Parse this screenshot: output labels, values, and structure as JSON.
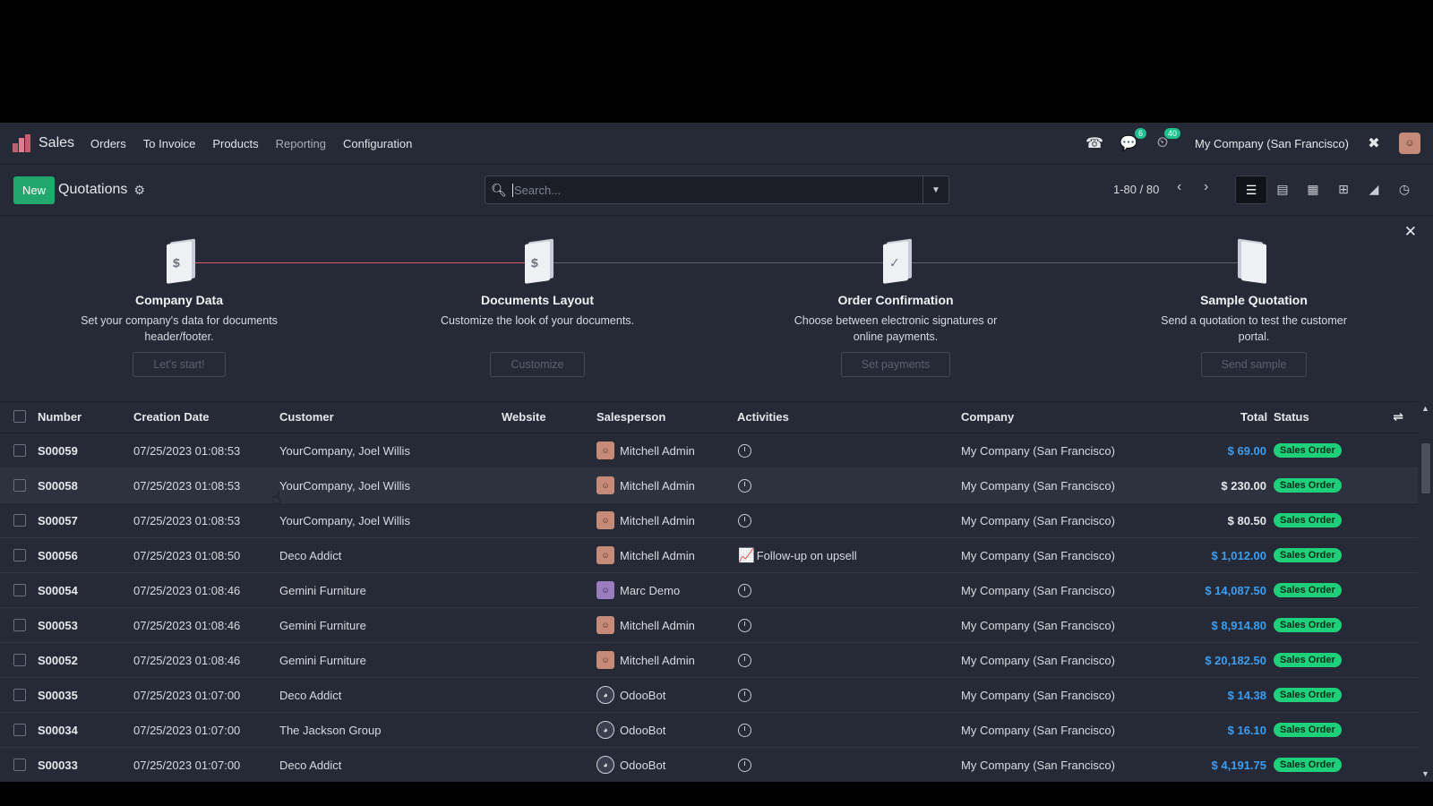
{
  "nav": {
    "app_name": "Sales",
    "menu": [
      "Orders",
      "To Invoice",
      "Products",
      "Reporting",
      "Configuration"
    ],
    "chat_badge": "6",
    "activity_badge": "40",
    "company": "My Company (San Francisco)"
  },
  "control": {
    "new_label": "New",
    "title": "Quotations",
    "search_placeholder": "Search...",
    "pager": "1-80 / 80"
  },
  "onboarding": {
    "steps": [
      {
        "title": "Company Data",
        "desc": "Set your company's data for documents header/footer.",
        "button": "Let's start!"
      },
      {
        "title": "Documents Layout",
        "desc": "Customize the look of your documents.",
        "button": "Customize"
      },
      {
        "title": "Order Confirmation",
        "desc": "Choose between electronic signatures or online payments.",
        "button": "Set payments"
      },
      {
        "title": "Sample Quotation",
        "desc": "Send a quotation to test the customer portal.",
        "button": "Send sample"
      }
    ]
  },
  "table": {
    "headers": {
      "number": "Number",
      "date": "Creation Date",
      "customer": "Customer",
      "website": "Website",
      "salesperson": "Salesperson",
      "activities": "Activities",
      "company": "Company",
      "total": "Total",
      "status": "Status"
    },
    "rows": [
      {
        "number": "S00059",
        "date": "07/25/2023 01:08:53",
        "customer": "YourCompany, Joel Willis",
        "salesperson": "Mitchell Admin",
        "activity": "",
        "company": "My Company (San Francisco)",
        "total": "$ 69.00",
        "status": "Sales Order"
      },
      {
        "number": "S00058",
        "date": "07/25/2023 01:08:53",
        "customer": "YourCompany, Joel Willis",
        "salesperson": "Mitchell Admin",
        "activity": "",
        "company": "My Company (San Francisco)",
        "total": "$ 230.00",
        "status": "Sales Order"
      },
      {
        "number": "S00057",
        "date": "07/25/2023 01:08:53",
        "customer": "YourCompany, Joel Willis",
        "salesperson": "Mitchell Admin",
        "activity": "",
        "company": "My Company (San Francisco)",
        "total": "$ 80.50",
        "status": "Sales Order"
      },
      {
        "number": "S00056",
        "date": "07/25/2023 01:08:50",
        "customer": "Deco Addict",
        "salesperson": "Mitchell Admin",
        "activity": "Follow-up on upsell",
        "company": "My Company (San Francisco)",
        "total": "$ 1,012.00",
        "status": "Sales Order"
      },
      {
        "number": "S00054",
        "date": "07/25/2023 01:08:46",
        "customer": "Gemini Furniture",
        "salesperson": "Marc Demo",
        "activity": "",
        "company": "My Company (San Francisco)",
        "total": "$ 14,087.50",
        "status": "Sales Order"
      },
      {
        "number": "S00053",
        "date": "07/25/2023 01:08:46",
        "customer": "Gemini Furniture",
        "salesperson": "Mitchell Admin",
        "activity": "",
        "company": "My Company (San Francisco)",
        "total": "$ 8,914.80",
        "status": "Sales Order"
      },
      {
        "number": "S00052",
        "date": "07/25/2023 01:08:46",
        "customer": "Gemini Furniture",
        "salesperson": "Mitchell Admin",
        "activity": "",
        "company": "My Company (San Francisco)",
        "total": "$ 20,182.50",
        "status": "Sales Order"
      },
      {
        "number": "S00035",
        "date": "07/25/2023 01:07:00",
        "customer": "Deco Addict",
        "salesperson": "OdooBot",
        "activity": "",
        "company": "My Company (San Francisco)",
        "total": "$ 14.38",
        "status": "Sales Order"
      },
      {
        "number": "S00034",
        "date": "07/25/2023 01:07:00",
        "customer": "The Jackson Group",
        "salesperson": "OdooBot",
        "activity": "",
        "company": "My Company (San Francisco)",
        "total": "$ 16.10",
        "status": "Sales Order"
      },
      {
        "number": "S00033",
        "date": "07/25/2023 01:07:00",
        "customer": "Deco Addict",
        "salesperson": "OdooBot",
        "activity": "",
        "company": "My Company (San Francisco)",
        "total": "$ 4,191.75",
        "status": "Sales Order"
      }
    ]
  },
  "colors": {
    "accent": "#22a86d",
    "status": "#1fd07a",
    "link_total": "#3d9df0",
    "background": "#262a36"
  }
}
